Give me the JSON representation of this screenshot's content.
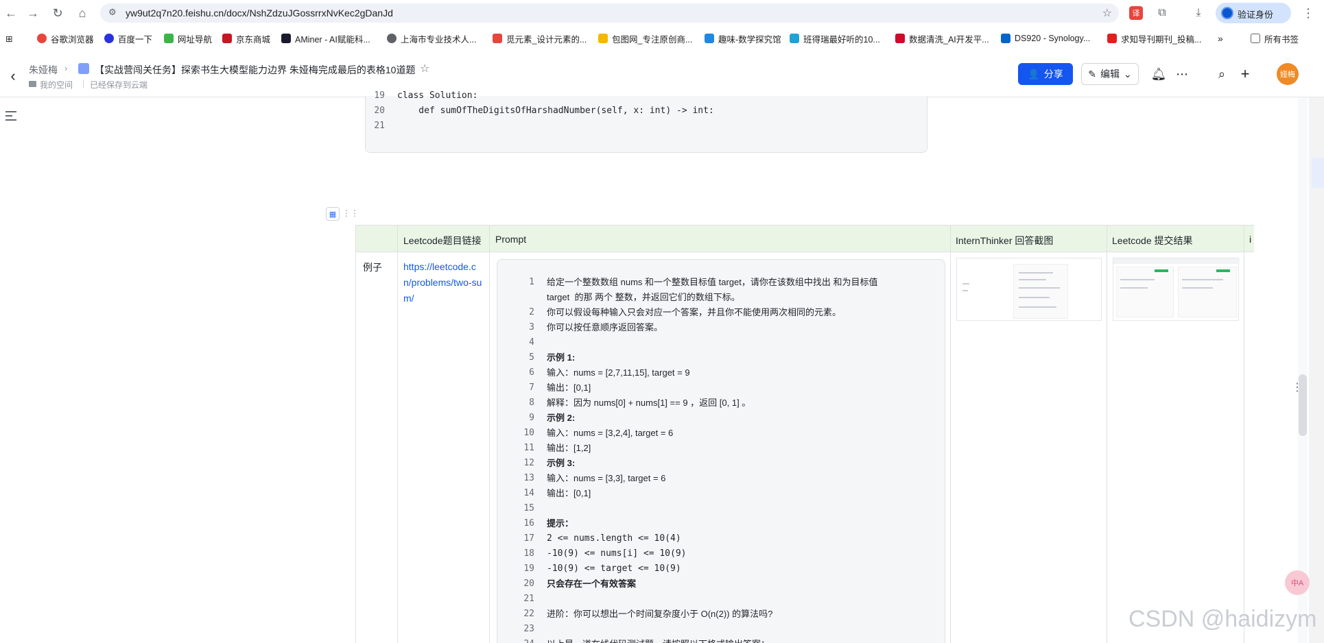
{
  "browser": {
    "url": "yw9ut2q7n20.feishu.cn/docx/NshZdzuJGossrrxNvKec2gDanJd",
    "verify_label": "验证身份",
    "bookmarks": [
      "谷歌浏览器",
      "百度一下",
      "网址导航",
      "京东商城",
      "AMiner - AI赋能科...",
      "上海市专业技术人...",
      "觅元素_设计元素的...",
      "包图网_专注原创商...",
      "趣味-数学探究馆",
      "班得瑞最好听的10...",
      "数据清洗_AI开发平...",
      "DS920 - Synology...",
      "求知导刊期刊_投稿..."
    ],
    "all_bookmarks_label": "所有书签",
    "bookmark_colors": [
      "#e8453c",
      "#2932e1",
      "#3bb54a",
      "#c81623",
      "#1a1a2e",
      "#5f6368",
      "#e8453c",
      "#f5b800",
      "#1e88e5",
      "#1fa3d6",
      "#cf0a2c",
      "#0066cc",
      "#e02020"
    ]
  },
  "doc": {
    "owner": "朱娅梅",
    "title": "【实战营闯关任务】探索书生大模型能力边界 朱娅梅完成最后的表格10道题",
    "space": "我的空间",
    "saved": "已经保存到云端",
    "share_label": "分享",
    "edit_label": "编辑",
    "avatar_text": "娅梅",
    "accent_color": "#1456f0"
  },
  "code_block": {
    "lines": [
      {
        "n": "19",
        "text": "class Solution:"
      },
      {
        "n": "20",
        "text": "    def sumOfTheDigitsOfHarshadNumber(self, x: int) -> int:"
      },
      {
        "n": "21",
        "text": ""
      }
    ]
  },
  "table": {
    "headers": [
      "",
      "Leetcode题目链接",
      "Prompt",
      "InternThinker 回答截图",
      "Leetcode 提交结果",
      "i"
    ],
    "row_label": "例子",
    "link": "https://leetcode.cn/problems/two-sum/",
    "prompt_lines": [
      {
        "n": "1",
        "text": "给定一个整数数组 nums 和一个整数目标值 target，请你在该数组中找出 和为目标值"
      },
      {
        "n": "",
        "text": "target  的那 两个 整数，并返回它们的数组下标。"
      },
      {
        "n": "2",
        "text": "你可以假设每种输入只会对应一个答案，并且你不能使用两次相同的元素。"
      },
      {
        "n": "3",
        "text": "你可以按任意顺序返回答案。"
      },
      {
        "n": "4",
        "text": ""
      },
      {
        "n": "5",
        "text": "示例 1:"
      },
      {
        "n": "6",
        "text": "输入：nums = [2,7,11,15], target = 9"
      },
      {
        "n": "7",
        "text": "输出：[0,1]"
      },
      {
        "n": "8",
        "text": "解释：因为 nums[0] + nums[1] == 9 ，返回 [0, 1] 。"
      },
      {
        "n": "9",
        "text": "示例 2:"
      },
      {
        "n": "10",
        "text": "输入：nums = [3,2,4], target = 6"
      },
      {
        "n": "11",
        "text": "输出：[1,2]"
      },
      {
        "n": "12",
        "text": "示例 3:"
      },
      {
        "n": "13",
        "text": "输入：nums = [3,3], target = 6"
      },
      {
        "n": "14",
        "text": "输出：[0,1]"
      },
      {
        "n": "15",
        "text": ""
      },
      {
        "n": "16",
        "text": "提示："
      },
      {
        "n": "17",
        "text": "2 <= nums.length <= 10(4)"
      },
      {
        "n": "18",
        "text": "-10(9) <= nums[i] <= 10(9)"
      },
      {
        "n": "19",
        "text": "-10(9) <= target <= 10(9)"
      },
      {
        "n": "20",
        "text": "只会存在一个有效答案"
      },
      {
        "n": "21",
        "text": ""
      },
      {
        "n": "22",
        "text": "进阶：你可以想出一个时间复杂度小于 O(n(2)) 的算法吗?"
      },
      {
        "n": "23",
        "text": ""
      },
      {
        "n": "24",
        "text": "以上是一道在线代码测试题，请按照以下格式输出答案："
      }
    ]
  },
  "watermark": "CSDN @haidizym",
  "translate_label": "中A"
}
